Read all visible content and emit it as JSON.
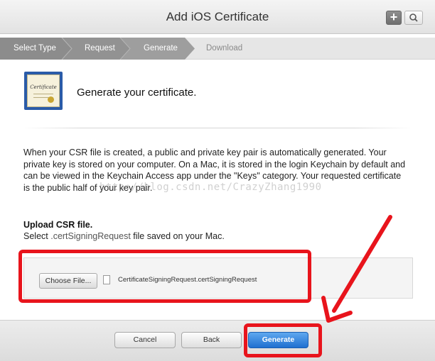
{
  "header": {
    "title": "Add iOS Certificate",
    "plus_label": "+"
  },
  "steps": [
    {
      "label": "Select Type",
      "state": "done"
    },
    {
      "label": "Request",
      "state": "done"
    },
    {
      "label": "Generate",
      "state": "current"
    },
    {
      "label": "Download",
      "state": "upcoming"
    }
  ],
  "certificate": {
    "icon_text": "Certificate",
    "heading": "Generate your certificate."
  },
  "description": "When your CSR file is created, a public and private key pair is automatically generated. Your private key is stored on your computer. On a Mac, it is stored in the login Keychain by default and can be viewed in the Keychain Access app under the \"Keys\" category. Your requested certificate is the public half of your key pair.",
  "watermark": "http://blog.csdn.net/CrazyZhang1990",
  "upload": {
    "title": "Upload CSR file.",
    "subtitle_prefix": "Select ",
    "subtitle_ext": ".certSigningRequest",
    "subtitle_suffix": " file saved on your Mac.",
    "choose_label": "Choose File...",
    "file_name": "CertificateSigningRequest.certSigningRequest"
  },
  "footer": {
    "cancel_label": "Cancel",
    "back_label": "Back",
    "generate_label": "Generate"
  },
  "colors": {
    "annotation_red": "#e8141c",
    "primary_blue": "#1f6fd0",
    "step_done": "#8a8a8a",
    "step_current": "#9a9a9a"
  },
  "icons": [
    "plus-icon",
    "search-icon",
    "certificate-icon",
    "file-icon"
  ]
}
